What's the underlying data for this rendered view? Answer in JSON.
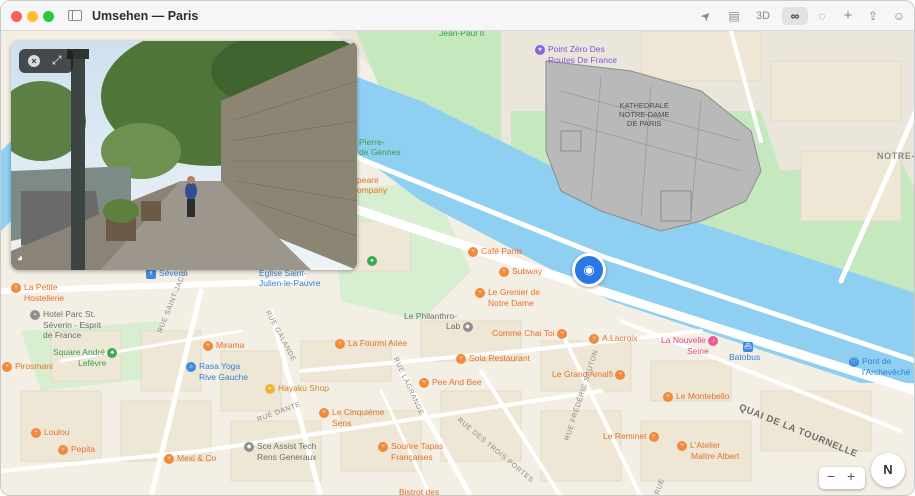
{
  "window": {
    "title": "Umsehen — Paris"
  },
  "toolbar": {
    "directions_icon": "➤",
    "map_mode_icon": "▤",
    "view_3d_label": "3D",
    "look_around_icon": "∞",
    "tracking_icon": "◌",
    "new_tab_icon": "+",
    "share_icon": "⇪",
    "account_icon": "☺"
  },
  "map": {
    "poi": {
      "jean_paul": "Jean-Paul II",
      "point_zero": [
        "Point Zéro Des",
        "Routes De France"
      ],
      "cathedrale": [
        "KATHEDRALE",
        "NOTRE-DAME",
        "DE PARIS"
      ],
      "notre_street": "NOTRE-",
      "pierre_gennes": [
        "Pierre-",
        "de Gennes"
      ],
      "shakespeare": [
        "peare",
        "ompany"
      ],
      "cafe_panis": "Café Panis",
      "subway": "Subway",
      "grenier": [
        "Le Grenier de",
        "Notre Dame"
      ],
      "eglise": [
        "Église Saint-",
        "Julien-le-Pauvre"
      ],
      "severin": "Séverin",
      "petite_hostellerie": [
        "La Petite",
        "Hostellerie"
      ],
      "hotel_parc": [
        "Hotel Parc St.",
        "Séverin - Esprit",
        "de France"
      ],
      "philanthro": [
        "Le Philanthro-",
        "Lab"
      ],
      "comme_chai": "Comme Chai Toi",
      "lacroix": "A.Lacroix",
      "nouvelle_seine": [
        "La Nouvelle",
        "Seine"
      ],
      "batobus": "Batobus",
      "pont_archeveche": [
        "Pont de",
        "l'Archevêché"
      ],
      "square_andre": [
        "Square André",
        "Lefèvre"
      ],
      "mirama": "Mirama",
      "fourmi": "La Fourmi Ailée",
      "sola": "Sola Restaurant",
      "grand_amalfi": "Le Grand Amalfi",
      "pirosmani": "Pirosmani",
      "rasa_yoga": [
        "Rasa Yoga",
        "Rive Gauche"
      ],
      "hayaku": "Hayaku Shop",
      "pee_and_bee": "Pee And Bee",
      "montebello": "Le Montebello",
      "cinquieme": [
        "Le Cinquième",
        "Sens"
      ],
      "loulou": "Loulou",
      "reminet": "Le Reminet",
      "atelier": [
        "L'Atelier",
        "Maître Albert"
      ],
      "sce_assist": [
        "Sce Assist Tech",
        "Rens Generaux"
      ],
      "sourire_tapas": [
        "Sourire Tapas",
        "Françaises"
      ],
      "pepita": "Pepita",
      "mexi": "Mexi & Co",
      "bistrot": "Bistrot des"
    },
    "streets": {
      "saint_jacques": "RUE SAINT-JACQUES",
      "galande": "RUE GALANDE",
      "lagrange": "RUE LAGRANGE",
      "dante": "RUE DANTE",
      "trois_portes": "RUE DES TROIS PORTES",
      "frederic_sauton": "RUE FRÉDÉRIC SAUTON",
      "tournelle": "QUAI DE LA TOURNELLE",
      "rue_short": "RUE"
    },
    "colors": {
      "water": "#8fd0f2",
      "park": "#c6e8bf",
      "land": "#f4efe4",
      "road": "#ffffff",
      "accent": "#2b78e4"
    }
  },
  "look_around": {
    "close_icon": "×",
    "expand_icon": "⤢",
    "attribution_icon": "◕"
  },
  "controls": {
    "zoom_out": "−",
    "zoom_in": "+",
    "compass_label": "N"
  }
}
